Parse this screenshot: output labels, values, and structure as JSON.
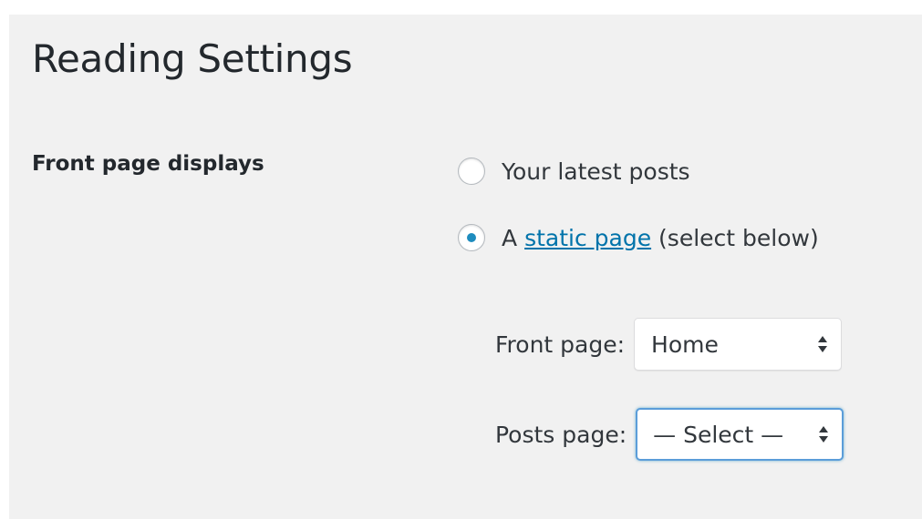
{
  "page": {
    "title": "Reading Settings"
  },
  "front_page_displays": {
    "label": "Front page displays",
    "options": [
      {
        "label": "Your latest posts",
        "checked": false
      },
      {
        "prefix": "A ",
        "link_text": "static page",
        "suffix": " (select below)",
        "checked": true
      }
    ]
  },
  "selects": {
    "front_page": {
      "label": "Front page:",
      "value": "Home"
    },
    "posts_page": {
      "label": "Posts page:",
      "value": "— Select —"
    }
  },
  "colors": {
    "background": "#f1f1f1",
    "link": "#0073aa",
    "radio_dot": "#1e8cbe",
    "focus_border": "#5b9dd9"
  },
  "icons": {
    "radio_unchecked": "radio-unchecked-icon",
    "radio_checked": "radio-checked-icon",
    "select_arrows": "updown-arrows-icon"
  }
}
